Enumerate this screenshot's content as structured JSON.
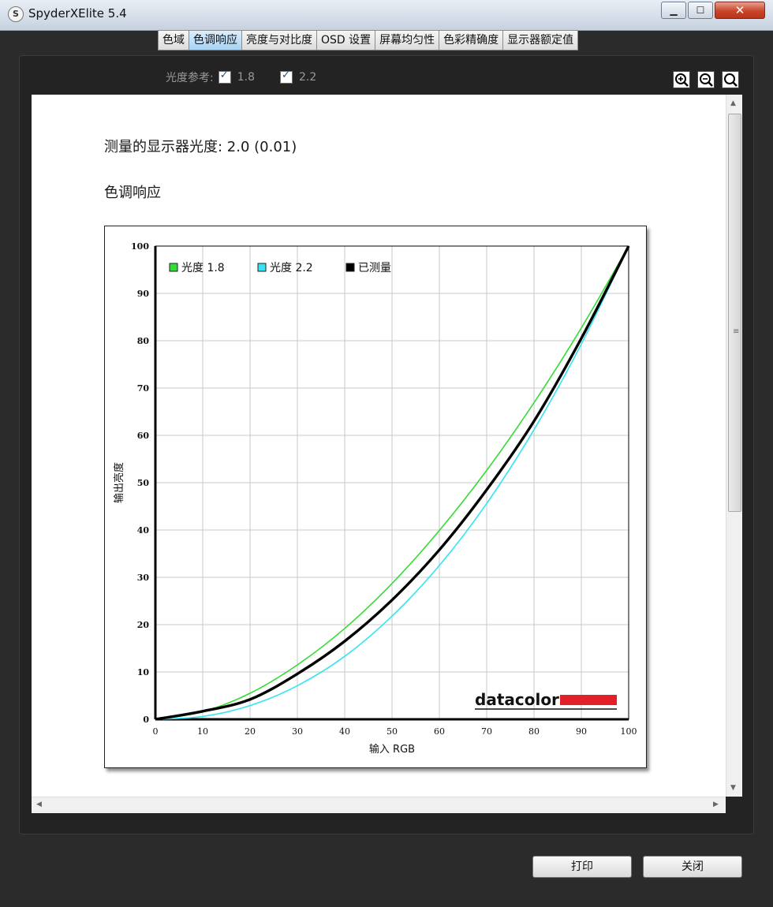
{
  "window": {
    "title": "SpyderXElite 5.4",
    "icon": "S"
  },
  "tabs": [
    {
      "label": "色域",
      "active": false
    },
    {
      "label": "色调响应",
      "active": true
    },
    {
      "label": "亮度与对比度",
      "active": false
    },
    {
      "label": "OSD 设置",
      "active": false
    },
    {
      "label": "屏幕均匀性",
      "active": false
    },
    {
      "label": "色彩精确度",
      "active": false
    },
    {
      "label": "显示器额定值",
      "active": false
    }
  ],
  "luminance_ref": {
    "label": "光度参考:",
    "options": [
      {
        "value": "1.8",
        "checked": true
      },
      {
        "value": "2.2",
        "checked": true
      }
    ]
  },
  "report": {
    "measured_gamma": "测量的显示器光度:  2.0 (0.01)",
    "section_title": "色调响应"
  },
  "chart_data": {
    "type": "line",
    "title": "",
    "xlabel": "输入 RGB",
    "ylabel": "输出亮度",
    "xlim": [
      0,
      100
    ],
    "ylim": [
      0,
      100
    ],
    "xticks": [
      "0",
      "10",
      "20",
      "30",
      "40",
      "50",
      "60",
      "70",
      "80",
      "90",
      "100"
    ],
    "yticks": [
      "0",
      "10",
      "20",
      "30",
      "40",
      "50",
      "60",
      "70",
      "80",
      "90",
      "100"
    ],
    "grid": true,
    "legend_position": "top-left",
    "x": [
      0,
      10,
      20,
      30,
      40,
      50,
      60,
      70,
      80,
      90,
      100
    ],
    "series": [
      {
        "name": "光度 1.8",
        "color": "#33dd33",
        "values": [
          0,
          1.6,
          5.5,
          11.5,
          19.2,
          28.7,
          39.9,
          52.6,
          66.9,
          82.7,
          100
        ]
      },
      {
        "name": "光度 2.2",
        "color": "#33e5f0",
        "values": [
          0,
          0.6,
          2.9,
          7.1,
          13.3,
          21.8,
          32.5,
          45.6,
          61.2,
          79.3,
          100
        ]
      },
      {
        "name": "已测量",
        "color": "#000000",
        "values": [
          0,
          1.7,
          4.2,
          9.6,
          16.5,
          25.2,
          35.8,
          48.5,
          63,
          80.5,
          100
        ]
      }
    ],
    "logo": "datacolor",
    "logo_colors": {
      "text": "#111111",
      "bar": "#e3202a"
    }
  },
  "buttons": {
    "print": "打印",
    "close": "关闭"
  }
}
